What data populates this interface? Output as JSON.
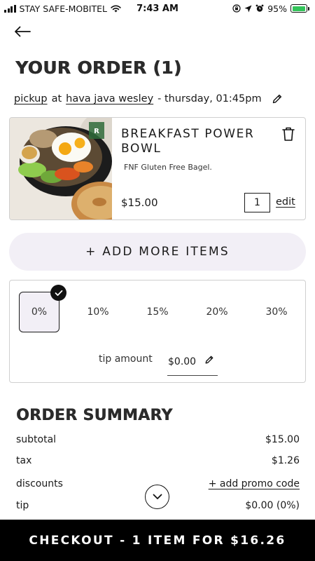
{
  "status_bar": {
    "carrier": "STAY SAFE-MOBITEL",
    "time": "7:43 AM",
    "battery": "95%",
    "battery_level": 0.95
  },
  "header": {
    "back_icon": "arrow-left-icon",
    "title": "YOUR ORDER (1)"
  },
  "order_meta": {
    "mode": "pickup",
    "at": "at",
    "location": "hava java wesley",
    "schedule": "- thursday, 01:45pm",
    "edit_icon": "pencil-icon"
  },
  "item": {
    "name": "BREAKFAST POWER BOWL",
    "description": "FNF Gluten Free Bagel.",
    "price": "$15.00",
    "quantity": "1",
    "edit_label": "edit",
    "delete_icon": "trash-icon",
    "image_icon": "breakfast-bowl-photo"
  },
  "add_more": {
    "label": "+ ADD MORE ITEMS"
  },
  "tip": {
    "options": [
      "0%",
      "10%",
      "15%",
      "20%",
      "30%"
    ],
    "selected_index": 0,
    "amount_label": "tip amount",
    "amount_value": "$0.00",
    "edit_icon": "pencil-icon"
  },
  "summary": {
    "title": "ORDER SUMMARY",
    "rows": [
      {
        "label": "subtotal",
        "value": "$15.00"
      },
      {
        "label": "tax",
        "value": "$1.26"
      },
      {
        "label": "discounts",
        "value": "+ add promo code"
      },
      {
        "label": "tip",
        "value": "$0.00 (0%)"
      }
    ]
  },
  "checkout": {
    "label": "CHECKOUT - 1 ITEM FOR $16.26"
  },
  "colors": {
    "accent_bg": "#f2eff6",
    "checkout_bg": "#000000",
    "battery": "#33c45a",
    "border": "#cfcfcf"
  }
}
